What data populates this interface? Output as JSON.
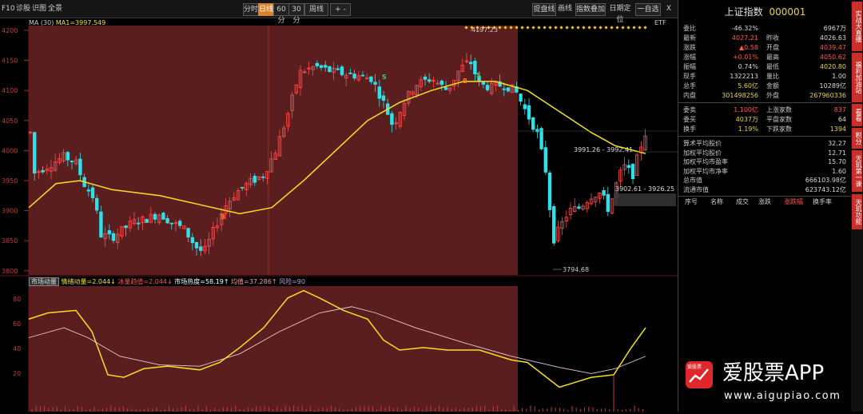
{
  "toolbar": {
    "left": [
      "F10",
      "诊股",
      "识图",
      "全景"
    ],
    "periods": [
      "分时",
      "日线",
      "60分",
      "30分",
      "周线"
    ],
    "active_period": "日线",
    "plus_minus": "+ -",
    "right": [
      "提盘线",
      "画线",
      "指数叠加",
      "日期定位",
      "一自选"
    ],
    "close": "X"
  },
  "ma_legend": {
    "label": "MA",
    "params": "(30)",
    "value": "MA1=3997.549"
  },
  "etf_label": "ETF",
  "price_axis": [
    "4200",
    "4150",
    "4100",
    "4050",
    "4000",
    "3950",
    "3900",
    "3850",
    "3800"
  ],
  "annotations": {
    "high": "4197.23",
    "low": "3794.68",
    "range1": "3991.26 - 3992.41",
    "range2": "3902.61 - 3926.25",
    "signals": [
      "S",
      "S",
      "B",
      "B"
    ]
  },
  "indicator": {
    "name": "市场动量",
    "legend": "情绪动量=2.044↓",
    "legend2": "冰量趋值=2.044↓",
    "legend3": "市场热度=58.19↑",
    "legend4": "均值=37.286↑",
    "legend5": "风险=90",
    "axis": [
      "80",
      "60",
      "40",
      "20"
    ]
  },
  "stock": {
    "name": "上证指数",
    "code": "000001"
  },
  "quote_rows": [
    {
      "l": "委比",
      "v": "-46.32%",
      "l2": "",
      "v2": "6967万"
    },
    {
      "l": "最新",
      "v": "4027.21",
      "l2": "昨收",
      "v2": "4026.63"
    },
    {
      "l": "涨跌",
      "v": "▲0.58",
      "l2": "开盘",
      "v2": "4039.47"
    },
    {
      "l": "涨幅",
      "v": "+0.01%",
      "l2": "最高",
      "v2": "4050.62"
    },
    {
      "l": "振幅",
      "v": "0.74%",
      "l2": "最低",
      "v2": "4020.80"
    },
    {
      "l": "现手",
      "v": "1322213",
      "l2": "量比",
      "v2": "1.00"
    },
    {
      "l": "总手",
      "v": "5.60亿",
      "l2": "金额",
      "v2": "10289亿"
    },
    {
      "l": "内盘",
      "v": "301498256",
      "l2": "外盘",
      "v2": "267960336"
    }
  ],
  "quote_rows2": [
    {
      "l": "委卖",
      "v": "1.100亿",
      "l2": "上涨家数",
      "v2": "837"
    },
    {
      "l": "委买",
      "v": "4037万",
      "l2": "平盘家数",
      "v2": "64"
    },
    {
      "l": "换手",
      "v": "1.19%",
      "l2": "下跌家数",
      "v2": "1394"
    }
  ],
  "stats_rows": [
    {
      "l": "算术平均股价",
      "v": "32.27"
    },
    {
      "l": "加权平均股价",
      "v": "12.71"
    },
    {
      "l": "加权平均市盈率",
      "v": "15.70"
    },
    {
      "l": "加权平均市净率",
      "v": "1.60"
    },
    {
      "l": "总市值",
      "v": "666103.98亿"
    },
    {
      "l": "流通市值",
      "v": "623743.12亿"
    }
  ],
  "table_headers": [
    "序号",
    "名称",
    "成交",
    "涨跌",
    "涨跌幅",
    "换手率"
  ],
  "sidebar": [
    "实战大直播",
    "福利加油站",
    "看看",
    "积分",
    "天玑第一课",
    "天玑功能"
  ],
  "logo": {
    "text": "爱股票APP",
    "url": "www.aigupiao.com",
    "badge": "爱股票"
  },
  "colors": {
    "up": "#ff4d4d",
    "down": "#2ee0e8",
    "ma": "#f5e020",
    "bg_left": "#5a1e1e"
  }
}
